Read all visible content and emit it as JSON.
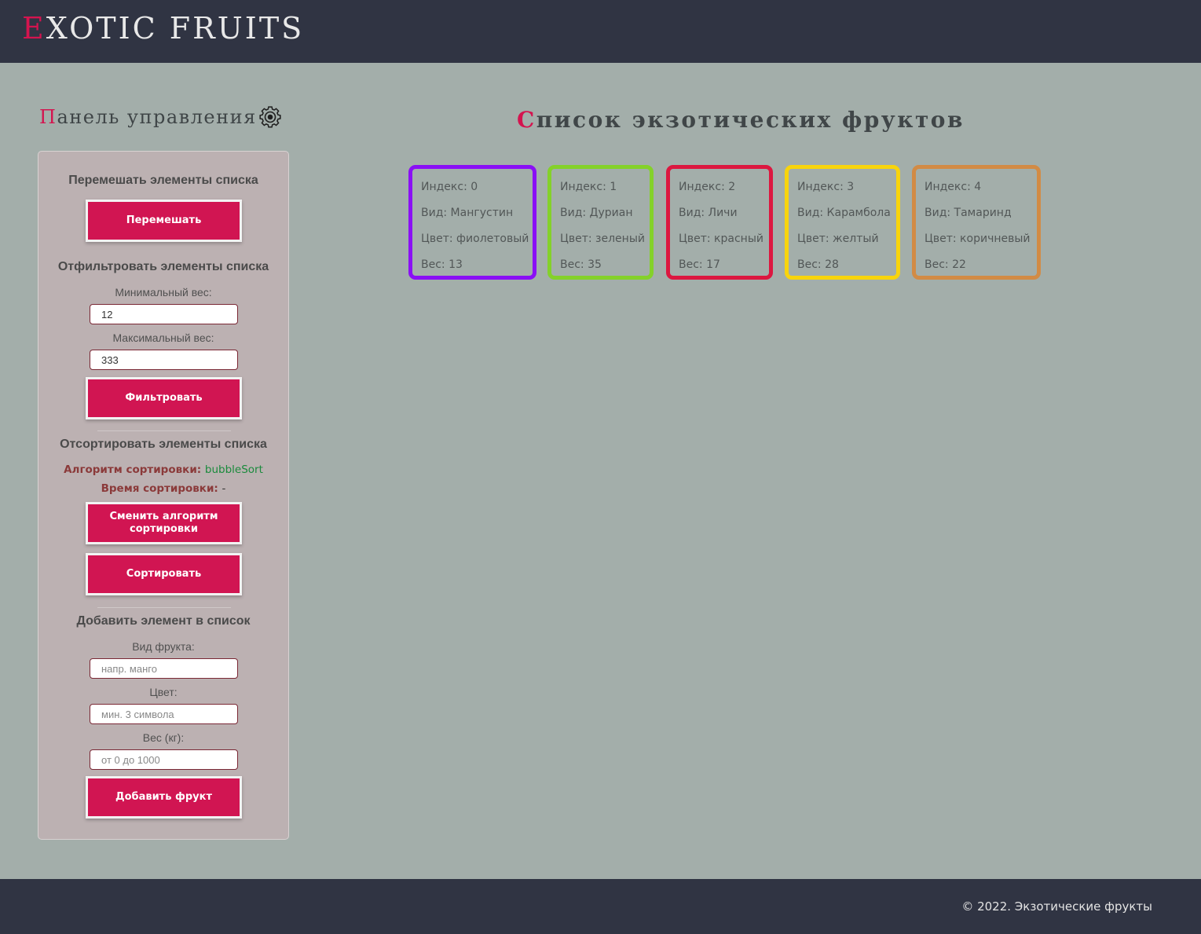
{
  "header": {
    "logo_first": "E",
    "logo_rest": "XOTIC FRUITS"
  },
  "control_panel": {
    "title_first": "П",
    "title_rest": "анель управления",
    "gear_icon": "gear-icon",
    "shuffle": {
      "heading": "Перемешать элементы списка",
      "button": "Перемешать"
    },
    "filter": {
      "heading": "Отфильтровать элементы списка",
      "min_label": "Минимальный вес:",
      "min_value": "12",
      "max_label": "Максимальный вес:",
      "max_value": "333",
      "button": "Фильтровать"
    },
    "sort": {
      "heading": "Отсортировать элементы списка",
      "algo_label": "Алгоритм сортировки:",
      "algo_value": "bubbleSort",
      "time_label": "Время сортировки:",
      "time_value": "-",
      "change_button": "Сменить алгоритм сортировки",
      "sort_button": "Сортировать"
    },
    "add": {
      "heading": "Добавить элемент в список",
      "kind_label": "Вид фрукта:",
      "kind_placeholder": "напр. манго",
      "color_label": "Цвет:",
      "color_placeholder": "мин. 3 символа",
      "weight_label": "Вес (кг):",
      "weight_placeholder": "от 0 до 1000",
      "button": "Добавить фрукт"
    }
  },
  "list": {
    "title_first": "С",
    "title_rest": "писок экзотических фруктов",
    "fruits": [
      {
        "index": "Индекс: 0",
        "kind": "Вид: Мангустин",
        "color": "Цвет: фиолетовый",
        "weight": "Вес: 13",
        "border": "#8a0ff5"
      },
      {
        "index": "Индекс: 1",
        "kind": "Вид: Дуриан",
        "color": "Цвет: зеленый",
        "weight": "Вес: 35",
        "border": "#84d12a"
      },
      {
        "index": "Индекс: 2",
        "kind": "Вид: Личи",
        "color": "Цвет: красный",
        "weight": "Вес: 17",
        "border": "#dc1740"
      },
      {
        "index": "Индекс: 3",
        "kind": "Вид: Карамбола",
        "color": "Цвет: желтый",
        "weight": "Вес: 28",
        "border": "#f8d40c"
      },
      {
        "index": "Индекс: 4",
        "kind": "Вид: Тамаринд",
        "color": "Цвет: коричневый",
        "weight": "Вес: 22",
        "border": "#d28b45"
      }
    ]
  },
  "footer": {
    "copyright": "© 2022. Экзотические фрукты"
  }
}
